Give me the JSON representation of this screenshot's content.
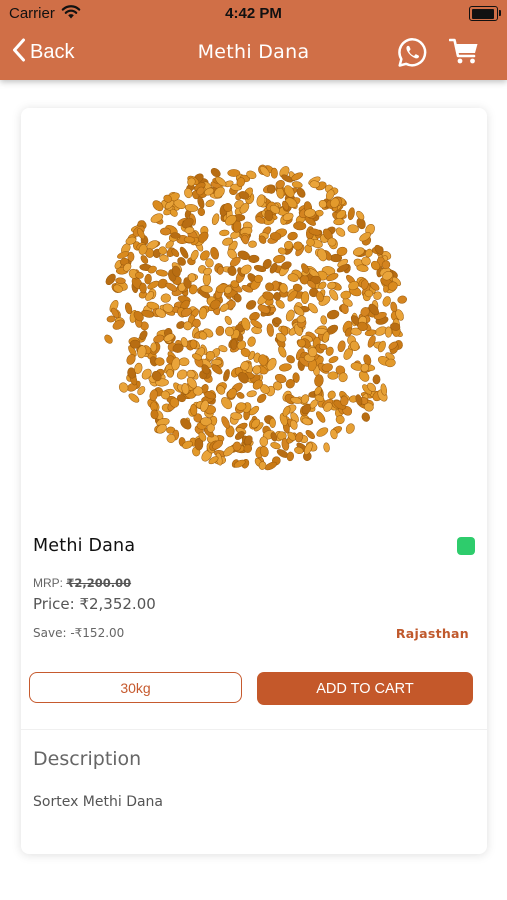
{
  "status_bar": {
    "carrier": "Carrier",
    "time": "4:42 PM"
  },
  "nav": {
    "back_label": "Back",
    "title": "Methi Dana",
    "whatsapp_icon": "whatsapp-icon",
    "cart_icon": "cart-icon",
    "bar_color": "#d06f47"
  },
  "product": {
    "name": "Methi Dana",
    "veg_indicator_color": "#2ecc6c",
    "mrp_label": "MRP:",
    "mrp_value": "₹2,200.00",
    "price_label": "Price:",
    "price_value": "₹2,352.00",
    "save_label": "Save:",
    "save_value": "-₹152.00",
    "origin": "Rajasthan",
    "quantity": "30kg",
    "add_to_cart_label": "ADD TO CART",
    "accent_color": "#c4582a"
  },
  "description": {
    "title": "Description",
    "text": "Sortex Methi Dana"
  }
}
